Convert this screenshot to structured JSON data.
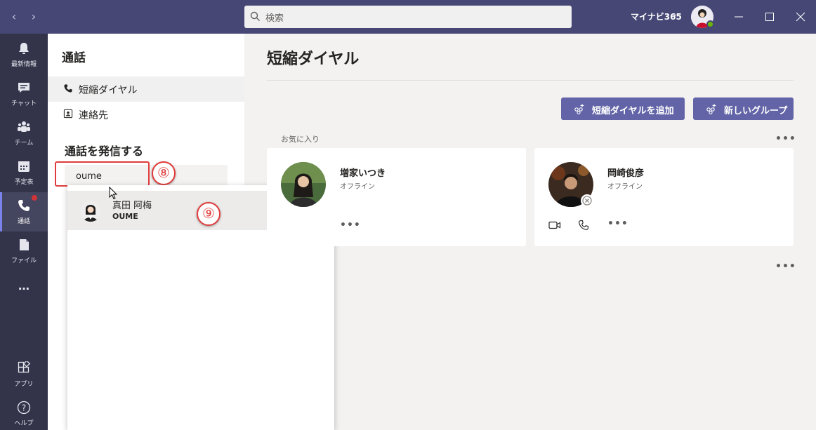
{
  "titlebar": {
    "search_placeholder": "検索",
    "tenant": "マイナビ365",
    "colors": {
      "bar": "#464775"
    }
  },
  "rail": {
    "items": [
      {
        "label": "最新情報",
        "icon": "bell-icon"
      },
      {
        "label": "チャット",
        "icon": "chat-icon"
      },
      {
        "label": "チーム",
        "icon": "teams-icon"
      },
      {
        "label": "予定表",
        "icon": "calendar-icon"
      },
      {
        "label": "通話",
        "icon": "phone-icon",
        "active": true
      },
      {
        "label": "ファイル",
        "icon": "file-icon"
      },
      {
        "label": "…",
        "icon": "more-icon"
      },
      {
        "label": "アプリ",
        "icon": "apps-icon"
      },
      {
        "label": "ヘルプ",
        "icon": "help-icon"
      }
    ]
  },
  "calls_panel": {
    "title": "通話",
    "items": [
      {
        "label": "短縮ダイヤル",
        "icon": "phone-icon",
        "selected": true
      },
      {
        "label": "連絡先",
        "icon": "contact-card-icon"
      }
    ],
    "make_call_title": "通話を発信する",
    "dial_input_value": "oume",
    "badge_8": "⑧"
  },
  "suggestions": {
    "items": [
      {
        "name": "真田 阿梅",
        "sub": "OUME"
      }
    ],
    "badge_9": "⑨"
  },
  "main": {
    "title": "短縮ダイヤル",
    "add_speed_dial_label": "短縮ダイヤルを追加",
    "new_group_label": "新しいグループ",
    "favorites_label": "お気に入り",
    "more_label": "•••",
    "contacts": [
      {
        "name": "増家いつき",
        "status": "オフライン"
      },
      {
        "name": "岡崎俊彦",
        "status": "オフライン"
      }
    ]
  }
}
